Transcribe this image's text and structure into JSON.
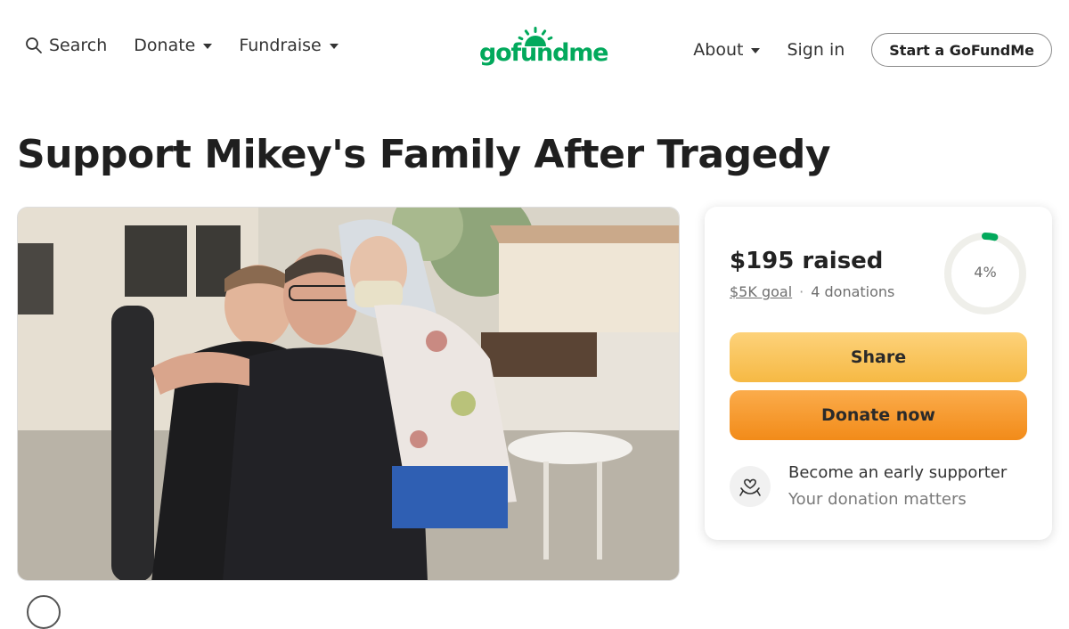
{
  "header": {
    "search_label": "Search",
    "donate_label": "Donate",
    "fundraise_label": "Fundraise",
    "logo_text": "gofundme",
    "about_label": "About",
    "signin_label": "Sign in",
    "start_label": "Start a GoFundMe"
  },
  "campaign": {
    "title": "Support Mikey's Family After Tragedy",
    "photo_icon": "campaign-photo"
  },
  "donation_card": {
    "raised": "$195 raised",
    "goal": "$5K goal",
    "separator": "·",
    "donations": "4 donations",
    "progress_label": "4%",
    "progress_fraction": 0.04,
    "share_label": "Share",
    "donate_label": "Donate now",
    "supporter_title": "Become an early supporter",
    "supporter_subtitle": "Your donation matters"
  },
  "colors": {
    "brand_green": "#02a95c",
    "share_yellow": "#f8c45a",
    "donate_orange": "#f59a2a",
    "ring_track": "#efefea"
  }
}
